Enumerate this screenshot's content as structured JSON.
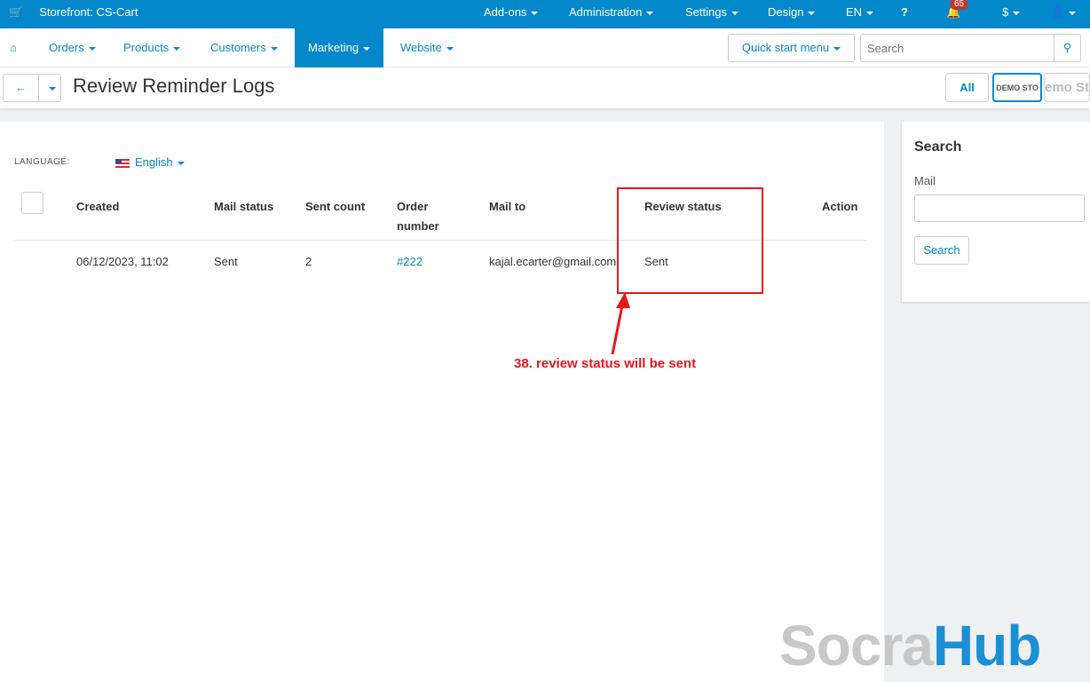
{
  "topbar": {
    "storefront": "Storefront: CS-Cart",
    "items": [
      "Add-ons",
      "Administration",
      "Settings",
      "Design",
      "EN"
    ],
    "notifications": "65",
    "currency": "$"
  },
  "nav": {
    "items": [
      "Orders",
      "Products",
      "Customers",
      "Marketing",
      "Website"
    ],
    "quick_start": "Quick start menu",
    "search_placeholder": "Search"
  },
  "header": {
    "title": "Review Reminder Logs",
    "all": "All",
    "demo": "DEMO STO",
    "demo2": "emo Sto"
  },
  "filter": {
    "language_label": "LANGUAGE:",
    "language": "English"
  },
  "table": {
    "headers": [
      "Created",
      "Mail status",
      "Sent count",
      "Order\nnumber",
      "Mail to",
      "Review status",
      "Action"
    ],
    "rows": [
      {
        "created": "06/12/2023, 11:02",
        "mail_status": "Sent",
        "sent_count": "2",
        "order": "#222",
        "mail_to": "kajal.ecarter@gmail.com",
        "review_status": "Sent"
      }
    ]
  },
  "annotation": "38. review status will be sent",
  "sidebar": {
    "title": "Search",
    "mail_label": "Mail",
    "button": "Search"
  },
  "watermark": {
    "a": "Socra",
    "b": "Hub"
  }
}
